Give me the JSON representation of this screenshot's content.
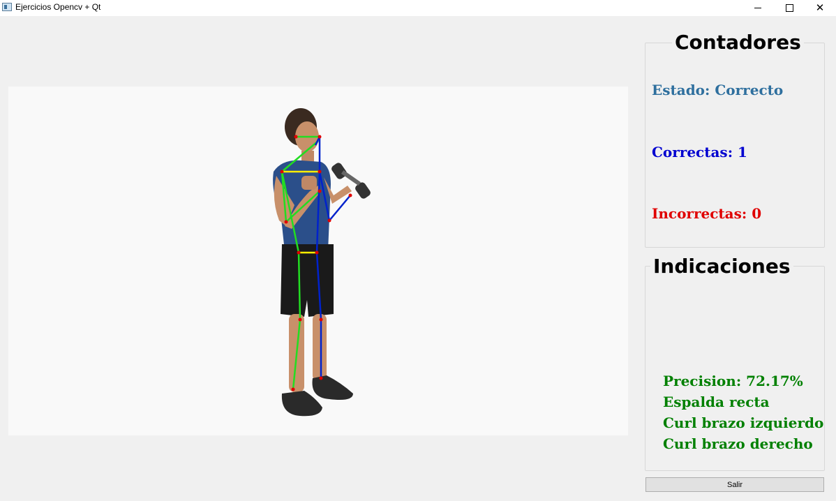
{
  "window": {
    "title": "Ejercicios Opencv + Qt"
  },
  "counters": {
    "title": "Contadores",
    "estado_label": "Estado:",
    "estado_value": "Correcto",
    "correctas_label": "Correctas:",
    "correctas_value": "1",
    "incorrectas_label": "Incorrectas:",
    "incorrectas_value": "0"
  },
  "indicaciones": {
    "title": "Indicaciones",
    "precision_label": "Precision:",
    "precision_value": "72.17%",
    "messages": [
      "Espalda recta",
      "Curl brazo izquierdo",
      "Curl brazo derecho"
    ]
  },
  "exit_button": {
    "label": "Salir"
  },
  "colors": {
    "estado": "#2e6f9e",
    "correctas": "#0000d0",
    "incorrectas": "#e00000",
    "hints": "#008000",
    "skeleton_left": "#22dd22",
    "skeleton_right": "#0022cc",
    "skeleton_cross": "#ffee00",
    "joints": "#e00000"
  }
}
